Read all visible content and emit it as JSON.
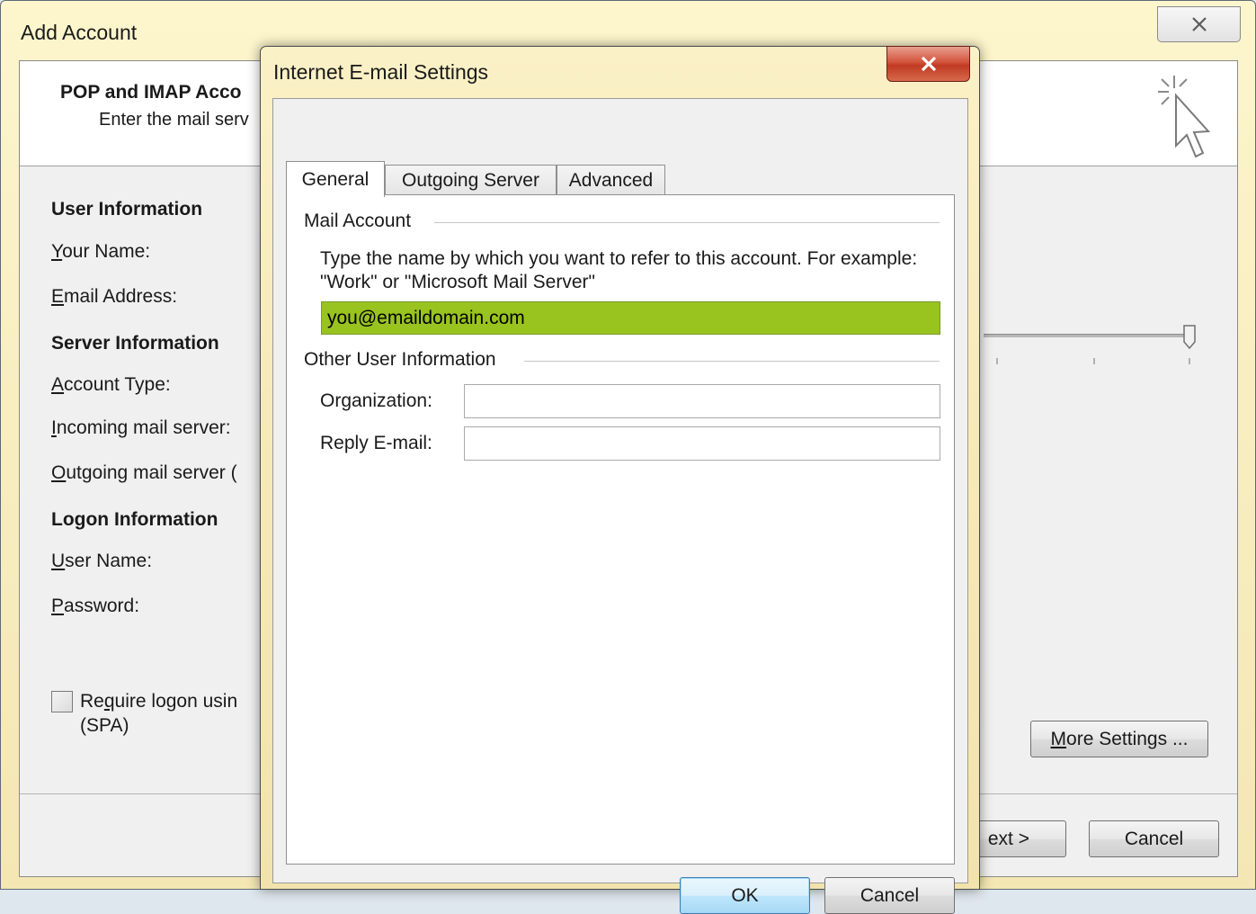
{
  "outer": {
    "title": "Add Account",
    "header_title": "POP and IMAP Acco",
    "header_subtitle": "Enter the mail serv",
    "sections": {
      "user_info": "User Information",
      "server_info": "Server Information",
      "logon_info": "Logon Information"
    },
    "labels": {
      "your_name_u": "Y",
      "your_name_rest": "our Name:",
      "email_u": "E",
      "email_rest": "mail Address:",
      "account_type_u": "A",
      "account_type_rest": "ccount Type:",
      "incoming_u": "I",
      "incoming_rest": "ncoming mail server:",
      "outgoing_u": "O",
      "outgoing_rest": "utgoing mail server (",
      "username_u": "U",
      "username_rest": "ser Name:",
      "password_u": "P",
      "password_rest": "assword:"
    },
    "spa": {
      "pre": "Re",
      "u": "q",
      "post": "uire logon usin",
      "line2": "(SPA)",
      "checked": false
    },
    "more_settings": {
      "u": "M",
      "rest": "ore Settings ..."
    },
    "next_label": "ext >",
    "cancel_label": "Cancel",
    "icons": {
      "close": "close-icon",
      "header": "cursor-click-icon",
      "slider": "slider-thumb-icon"
    }
  },
  "dialog": {
    "title": "Internet E-mail Settings",
    "tabs": [
      {
        "label": "General",
        "active": true
      },
      {
        "label": "Outgoing Server",
        "active": false
      },
      {
        "label": "Advanced",
        "active": false
      }
    ],
    "mail_account": {
      "group_label": "Mail Account",
      "description": "Type the name by which you want to refer to this account. For example: \"Work\" or \"Microsoft Mail Server\"",
      "value": "you@emaildomain.com"
    },
    "other_user_info": {
      "group_label": "Other User Information",
      "organization_label": "Organization:",
      "organization_value": "",
      "reply_email_label": "Reply E-mail:",
      "reply_email_value": ""
    },
    "ok_label": "OK",
    "cancel_label": "Cancel",
    "colors": {
      "highlight": "#99c31f",
      "close_button": "#c03a21"
    }
  }
}
